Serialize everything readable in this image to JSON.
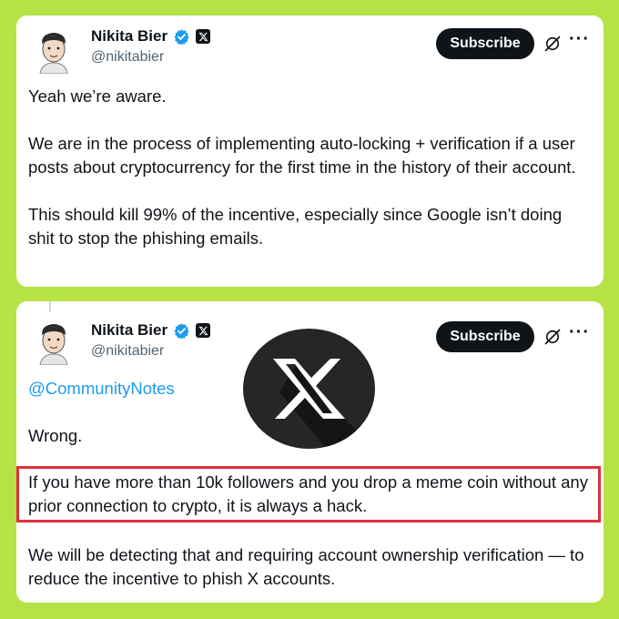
{
  "tweets": [
    {
      "author_name": "Nikita Bier",
      "handle": "@nikitabier",
      "subscribe_label": "Subscribe",
      "more_label": "···",
      "paragraphs": [
        "Yeah we’re aware.",
        "We are in the process of implementing auto-locking + verification if a user posts about cryptocurrency for the first time in the history of their account.",
        "This should kill 99% of the incentive, especially since Google isn’t doing shit to stop the phishing emails."
      ]
    },
    {
      "author_name": "Nikita Bier",
      "handle": "@nikitabier",
      "subscribe_label": "Subscribe",
      "more_label": "···",
      "mention": "@CommunityNotes",
      "paragraphs": [
        "Wrong.",
        "If you have more than 10k followers and you drop a meme coin without any prior connection to crypto, it is always a hack.",
        "We will be detecting that and requiring account ownership verification — to reduce the incentive to phish X accounts."
      ]
    }
  ],
  "colors": {
    "background": "#b5e244",
    "verified": "#1d9bf0",
    "highlight_border": "#e0303a",
    "mention": "#1d9bf0"
  },
  "icons": [
    "verified-badge-icon",
    "x-logo-icon",
    "grok-icon",
    "more-options-icon",
    "x-logo-circle"
  ]
}
